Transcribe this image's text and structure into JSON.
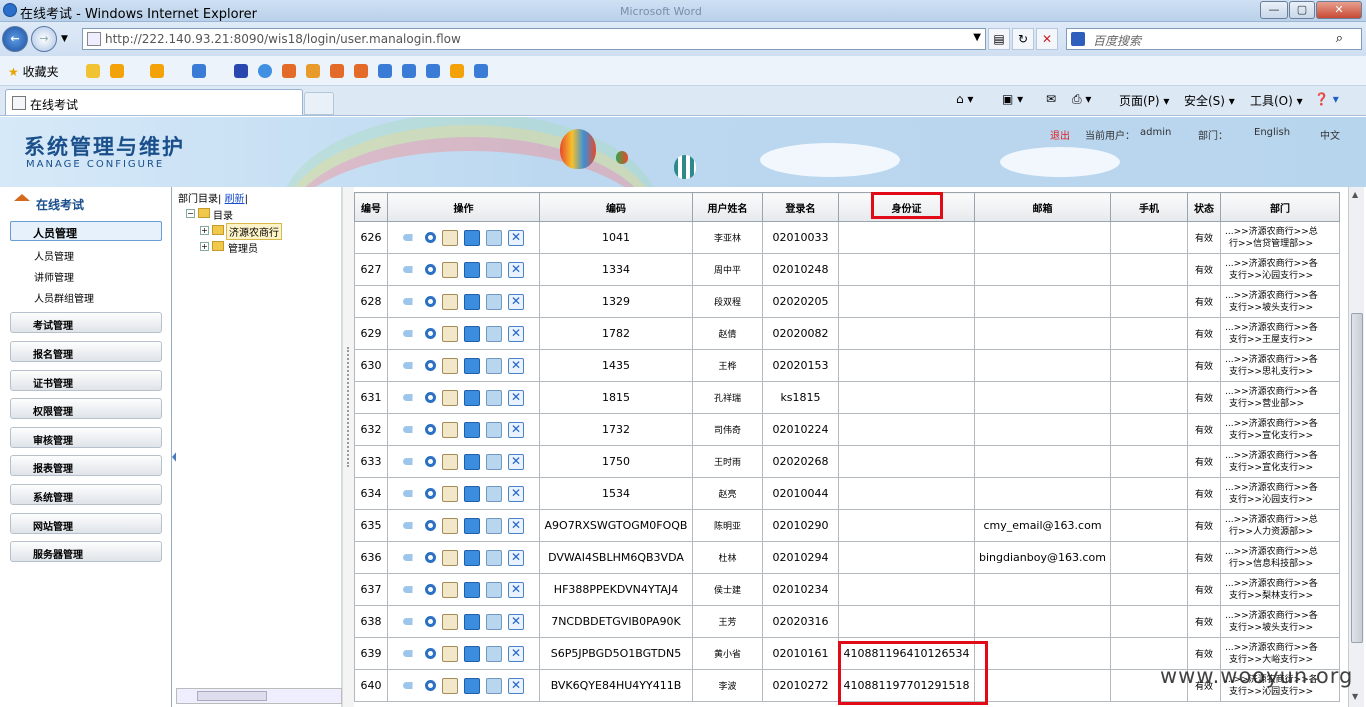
{
  "browser": {
    "title": "在线考试 - Windows Internet Explorer",
    "faded_title": "Microsoft Word",
    "url": "http://222.140.93.21:8090/wis18/login/user.manalogin.flow",
    "search_placeholder": "百度搜索",
    "favorites_label": "收藏夹",
    "tab_title": "在线考试",
    "cmd_page": "页面(P)",
    "cmd_safety": "安全(S)",
    "cmd_tools": "工具(O)"
  },
  "header": {
    "title": "系统管理与维护",
    "subtitle": "MANAGE CONFIGURE",
    "logout": "退出",
    "current_user_label": "当前用户：",
    "current_user": "admin",
    "dept_label": "部门：",
    "lang_en": "English",
    "lang_zh": "中文"
  },
  "leftnav": {
    "heading": "在线考试",
    "selected": "人员管理",
    "subitems": [
      "人员管理",
      "讲师管理",
      "人员群组管理"
    ],
    "groups": [
      "考试管理",
      "报名管理",
      "证书管理",
      "权限管理",
      "审核管理",
      "报表管理",
      "系统管理",
      "网站管理",
      "服务器管理"
    ]
  },
  "tree": {
    "header_label": "部门目录",
    "refresh": "刷新",
    "root": "目录",
    "nodes": [
      "济源农商行",
      "管理员"
    ]
  },
  "table": {
    "headers": [
      "编号",
      "操作",
      "编码",
      "用户姓名",
      "登录名",
      "身份证",
      "邮箱",
      "手机",
      "状态",
      "部门"
    ],
    "rows": [
      {
        "no": "626",
        "code": "1041",
        "name": "李亚林",
        "login": "02010033",
        "idcard": "",
        "email": "",
        "phone": "",
        "status": "有效",
        "dept1": "...>>济源农商行>>总",
        "dept2": "行>>信贷管理部>>"
      },
      {
        "no": "627",
        "code": "1334",
        "name": "周中平",
        "login": "02010248",
        "idcard": "",
        "email": "",
        "phone": "",
        "status": "有效",
        "dept1": "...>>济源农商行>>各",
        "dept2": "支行>>沁园支行>>"
      },
      {
        "no": "628",
        "code": "1329",
        "name": "段双程",
        "login": "02020205",
        "idcard": "",
        "email": "",
        "phone": "",
        "status": "有效",
        "dept1": "...>>济源农商行>>各",
        "dept2": "支行>>坡头支行>>"
      },
      {
        "no": "629",
        "code": "1782",
        "name": "赵倩",
        "login": "02020082",
        "idcard": "",
        "email": "",
        "phone": "",
        "status": "有效",
        "dept1": "...>>济源农商行>>各",
        "dept2": "支行>>王屋支行>>"
      },
      {
        "no": "630",
        "code": "1435",
        "name": "王桦",
        "login": "02020153",
        "idcard": "",
        "email": "",
        "phone": "",
        "status": "有效",
        "dept1": "...>>济源农商行>>各",
        "dept2": "支行>>思礼支行>>"
      },
      {
        "no": "631",
        "code": "1815",
        "name": "孔祥瑞",
        "login": "ks1815",
        "idcard": "",
        "email": "",
        "phone": "",
        "status": "有效",
        "dept1": "...>>济源农商行>>各",
        "dept2": "支行>>营业部>>"
      },
      {
        "no": "632",
        "code": "1732",
        "name": "司伟奇",
        "login": "02010224",
        "idcard": "",
        "email": "",
        "phone": "",
        "status": "有效",
        "dept1": "...>>济源农商行>>各",
        "dept2": "支行>>宣化支行>>"
      },
      {
        "no": "633",
        "code": "1750",
        "name": "王时雨",
        "login": "02020268",
        "idcard": "",
        "email": "",
        "phone": "",
        "status": "有效",
        "dept1": "...>>济源农商行>>各",
        "dept2": "支行>>宣化支行>>"
      },
      {
        "no": "634",
        "code": "1534",
        "name": "赵亮",
        "login": "02010044",
        "idcard": "",
        "email": "",
        "phone": "",
        "status": "有效",
        "dept1": "...>>济源农商行>>各",
        "dept2": "支行>>沁园支行>>"
      },
      {
        "no": "635",
        "code": "A9O7RXSWGTOGM0FOQB",
        "name": "陈明亚",
        "login": "02010290",
        "idcard": "",
        "email": "cmy_email@163.com",
        "phone": "",
        "status": "有效",
        "dept1": "...>>济源农商行>>总",
        "dept2": "行>>人力资源部>>"
      },
      {
        "no": "636",
        "code": "DVWAI4SBLHM6QB3VDA",
        "name": "杜林",
        "login": "02010294",
        "idcard": "",
        "email": "bingdianboy@163.com",
        "phone": "",
        "status": "有效",
        "dept1": "...>>济源农商行>>总",
        "dept2": "行>>信息科技部>>"
      },
      {
        "no": "637",
        "code": "HF388PPEKDVN4YTAJ4",
        "name": "侯士建",
        "login": "02010234",
        "idcard": "",
        "email": "",
        "phone": "",
        "status": "有效",
        "dept1": "...>>济源农商行>>各",
        "dept2": "支行>>梨林支行>>"
      },
      {
        "no": "638",
        "code": "7NCDBDETGVIB0PA90K",
        "name": "王芳",
        "login": "02020316",
        "idcard": "",
        "email": "",
        "phone": "",
        "status": "有效",
        "dept1": "...>>济源农商行>>各",
        "dept2": "支行>>坡头支行>>"
      },
      {
        "no": "639",
        "code": "S6P5JPBGD5O1BGTDN5",
        "name": "黄小省",
        "login": "02010161",
        "idcard": "410881196410126534",
        "email": "",
        "phone": "",
        "status": "有效",
        "dept1": "...>>济源农商行>>各",
        "dept2": "支行>>大峪支行>>"
      },
      {
        "no": "640",
        "code": "BVK6QYE84HU4YY411B",
        "name": "李波",
        "login": "02010272",
        "idcard": "410881197701291518",
        "email": "",
        "phone": "",
        "status": "有效",
        "dept1": "...>>济源农商行>>各",
        "dept2": "支行>>沁园支行>>"
      }
    ]
  },
  "watermark": "www.wooyun.org",
  "colors": {
    "highlight": "#e00b16",
    "brand": "#1a4f8b"
  }
}
